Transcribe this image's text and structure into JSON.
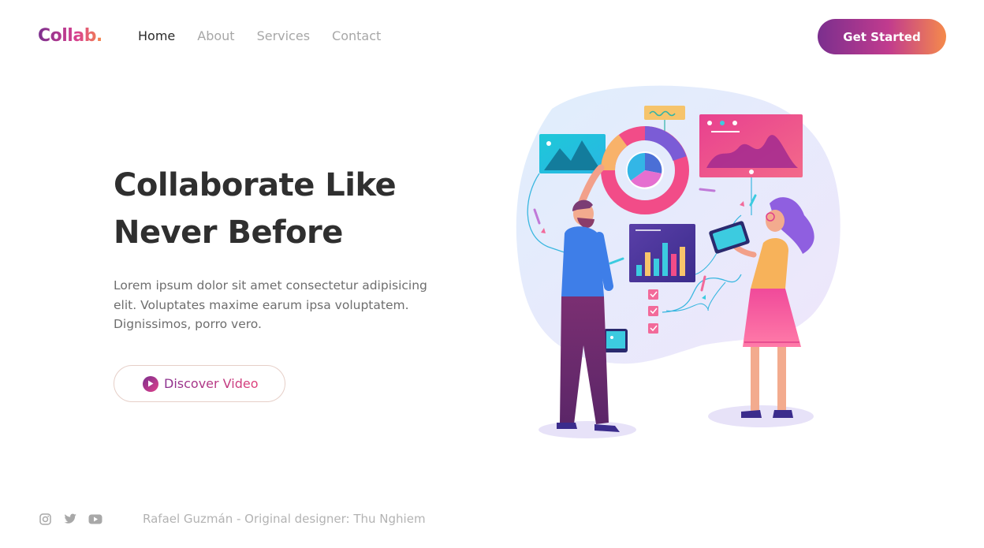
{
  "brand": {
    "logo": "Collab."
  },
  "nav": {
    "items": [
      {
        "label": "Home",
        "active": true
      },
      {
        "label": "About",
        "active": false
      },
      {
        "label": "Services",
        "active": false
      },
      {
        "label": "Contact",
        "active": false
      }
    ]
  },
  "header": {
    "cta_label": "Get Started"
  },
  "hero": {
    "title_line1": "Collaborate Like",
    "title_line2": "Never Before",
    "description": "Lorem ipsum dolor sit amet consectetur adipisicing elit. Voluptates maxime earum ipsa voluptatem. Dignissimos, porro vero.",
    "video_button_label": "Discover Video"
  },
  "footer": {
    "social_icons": [
      "instagram-icon",
      "twitter-icon",
      "youtube-icon"
    ],
    "credit": "Rafael Guzmán - Original designer: Thu Nghiem"
  },
  "colors": {
    "brand_purple": "#7b2f8e",
    "brand_pink": "#e0408a",
    "brand_orange": "#f58a4b",
    "heading": "#2f2f2f",
    "muted": "#a7a7a7"
  }
}
